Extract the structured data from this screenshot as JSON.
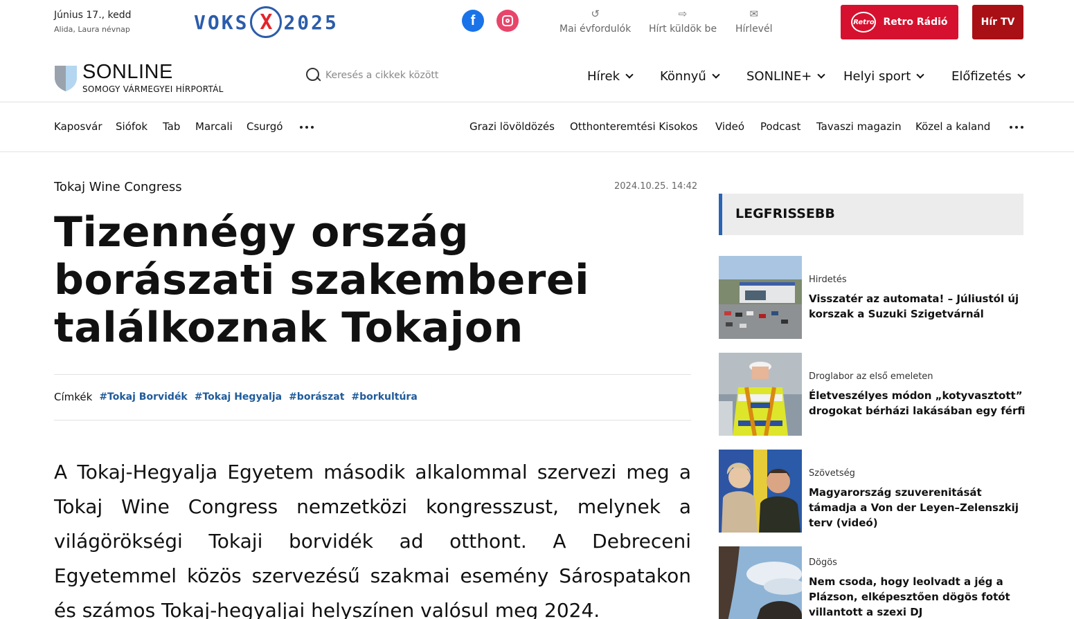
{
  "topbar": {
    "date": "Június 17., kedd",
    "nameday": "Alida, Laura névnap",
    "voks_left": "VOKS",
    "voks_x": "X",
    "voks_right": "2025",
    "social": {
      "facebook": "f"
    },
    "utility": [
      {
        "label": "Mai évfordulók",
        "icon": "history-icon"
      },
      {
        "label": "Hírt küldök be",
        "icon": "send-icon"
      },
      {
        "label": "Hírlevél",
        "icon": "mail-icon"
      }
    ],
    "retro_logo": "Retro",
    "retro_label": "Retro Rádió",
    "hirtv_label": "Hír TV"
  },
  "header": {
    "logo_name": "SONLINE",
    "logo_sub": "SOMOGY VÁRMEGYEI HÍRPORTÁL",
    "search_placeholder": "Keresés a cikkek között",
    "nav": [
      "Hírek",
      "Könnyű",
      "SONLINE+",
      "Helyi sport",
      "Előfizetés"
    ]
  },
  "subnav": {
    "left": [
      "Kaposvár",
      "Siófok",
      "Tab",
      "Marcali",
      "Csurgó"
    ],
    "right": [
      "Grazi lövöldözés",
      "Otthonteremtési Kisokos",
      "Videó",
      "Podcast",
      "Tavaszi magazin",
      "Közel a kaland"
    ]
  },
  "article": {
    "kicker": "Tokaj Wine Congress",
    "date": "2024.10.25. 14:42",
    "headline": "Tizennégy ország borászati szakemberei találkoznak Tokajon",
    "tags_label": "Címkék",
    "tags": [
      "#Tokaj Borvidék",
      "#Tokaj Hegyalja",
      "#borászat",
      "#borkultúra"
    ],
    "lead": "A Tokaj-Hegyalja Egyetem második alkalommal szervezi meg a Tokaj Wine Congress nemzetközi kongresszust, melynek a világörökségi Tokaji borvidék ad otthont. A Debreceni Egyetemmel közös szervezésű szakmai esemény Sárospatakon és számos Tokaj-hegyaljai helyszínen valósul meg 2024."
  },
  "sidebar": {
    "heading": "LEGFRISSEBB",
    "items": [
      {
        "category": "Hirdetés",
        "title": "Visszatér az automata! – Júliustól új korszak a Suzuki Szigetvárnál"
      },
      {
        "category": "Droglabor az első emeleten",
        "title": "Életveszélyes módon „kotyvasztott” drogokat bérházi lakásában egy férfi"
      },
      {
        "category": "Szövetség",
        "title": "Magyarország szuverenitását támadja a Von der Leyen–Zelenszkij terv (videó)"
      },
      {
        "category": "Dögös",
        "title": "Nem csoda, hogy leolvadt a jég a Plázson, elképesztően dögös fotót villantott a szexi DJ"
      }
    ]
  },
  "colors": {
    "brand_blue": "#2b63b5",
    "retro_red": "#d6112f",
    "hirtv_red": "#a81016",
    "tag_blue": "#1f5b9b"
  }
}
